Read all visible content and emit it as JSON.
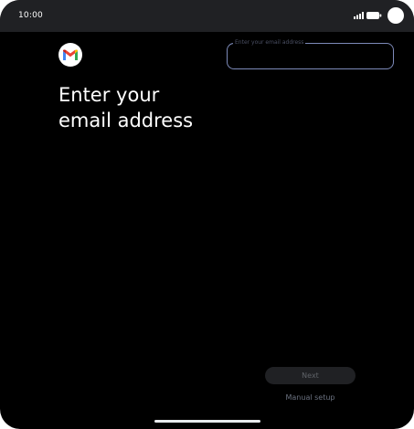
{
  "status_bar": {
    "time": "10:00",
    "icons": [
      "signal-icon",
      "battery-icon",
      "camera-icon"
    ]
  },
  "logo": {
    "icon": "gmail-logo-icon",
    "colors": [
      "#EA4335",
      "#FBBC04",
      "#34A853",
      "#4285F4"
    ]
  },
  "main": {
    "title": "Enter your email address"
  },
  "email_field": {
    "label": "Enter your email address",
    "value": ""
  },
  "actions": {
    "next_label": "Next",
    "manual_setup_label": "Manual setup"
  },
  "colors": {
    "background": "#000000",
    "status_bar": "#202124",
    "field_outline": "#7d8ab9"
  }
}
